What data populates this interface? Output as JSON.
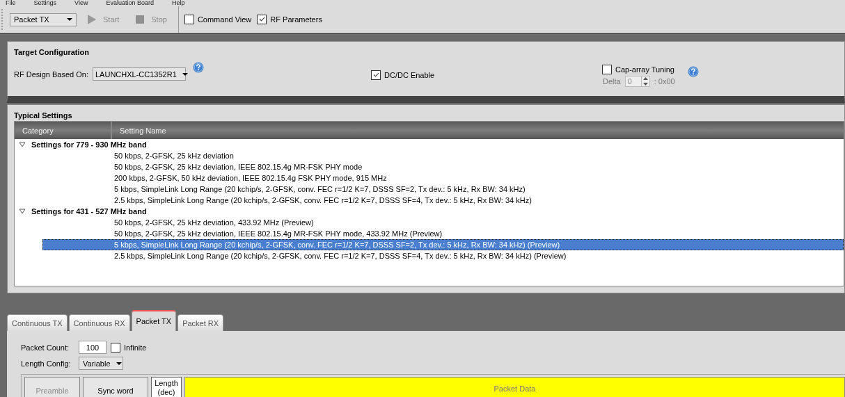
{
  "menu": [
    "File",
    "Settings",
    "View",
    "Evaluation Board",
    "Help"
  ],
  "toolbar": {
    "mode": "Packet TX",
    "start": {
      "label": "Start",
      "disabled": true
    },
    "stop": {
      "label": "Stop",
      "disabled": true
    },
    "toggles": [
      {
        "label": "Command View",
        "checked": false
      },
      {
        "label": "RF Parameters",
        "checked": true
      }
    ]
  },
  "target_configuration": {
    "title": "Target Configuration",
    "design_label": "RF Design Based On:",
    "design_value": "LAUNCHXL-CC1352R1",
    "dcdc": {
      "label": "DC/DC Enable",
      "checked": true
    },
    "cap_array": {
      "label": "Cap-array Tuning",
      "checked": false,
      "delta_label": "Delta",
      "delta_value": "0",
      "hex": ": 0x00"
    }
  },
  "typical_settings": {
    "title": "Typical Settings",
    "columns": [
      "Category",
      "Setting Name"
    ],
    "groups": [
      {
        "label": "Settings for 779 - 930 MHz band",
        "expanded": true,
        "children": [
          {
            "label": "50 kbps, 2-GFSK, 25 kHz deviation",
            "selected": false
          },
          {
            "label": "50 kbps, 2-GFSK, 25 kHz deviation, IEEE 802.15.4g MR-FSK PHY mode",
            "selected": false
          },
          {
            "label": "200 kbps, 2-GFSK, 50 kHz deviation, IEEE 802.15.4g FSK PHY mode, 915 MHz",
            "selected": false
          },
          {
            "label": "5 kbps, SimpleLink Long Range (20 kchip/s, 2-GFSK, conv. FEC r=1/2 K=7, DSSS SF=2, Tx dev.: 5 kHz, Rx BW: 34 kHz)",
            "selected": false
          },
          {
            "label": "2.5 kbps, SimpleLink Long Range (20 kchip/s, 2-GFSK, conv. FEC r=1/2 K=7, DSSS SF=4, Tx dev.: 5 kHz, Rx BW: 34 kHz)",
            "selected": false
          }
        ]
      },
      {
        "label": "Settings for 431 - 527 MHz band",
        "expanded": true,
        "children": [
          {
            "label": "50 kbps, 2-GFSK, 25 kHz deviation, 433.92 MHz (Preview)",
            "selected": false
          },
          {
            "label": "50 kbps, 2-GFSK, 25 kHz deviation, IEEE 802.15.4g MR-FSK PHY mode, 433.92 MHz (Preview)",
            "selected": false
          },
          {
            "label": "5 kbps, SimpleLink Long Range (20 kchip/s, 2-GFSK, conv. FEC r=1/2 K=7, DSSS SF=2, Tx dev.: 5 kHz, Rx BW: 34 kHz) (Preview)",
            "selected": true
          },
          {
            "label": "2.5 kbps, SimpleLink Long Range (20 kchip/s, 2-GFSK, conv. FEC r=1/2 K=7, DSSS SF=4, Tx dev.: 5 kHz, Rx BW: 34 kHz) (Preview)",
            "selected": false
          }
        ]
      }
    ]
  },
  "tabs": [
    {
      "label": "Continuous TX",
      "selected": false
    },
    {
      "label": "Continuous RX",
      "selected": false
    },
    {
      "label": "Packet TX",
      "selected": true
    },
    {
      "label": "Packet RX",
      "selected": false
    }
  ],
  "packet_tx": {
    "count_label": "Packet Count:",
    "count_value": "100",
    "infinite": {
      "label": "Infinite",
      "checked": false
    },
    "length_label": "Length Config:",
    "length_value": "Variable",
    "fields": [
      {
        "label": "Preamble",
        "kind": "disabled"
      },
      {
        "label": "Sync word",
        "kind": "normal"
      },
      {
        "label": "Length (dec)",
        "kind": "white"
      },
      {
        "label": "Packet Data",
        "kind": "data"
      }
    ]
  }
}
